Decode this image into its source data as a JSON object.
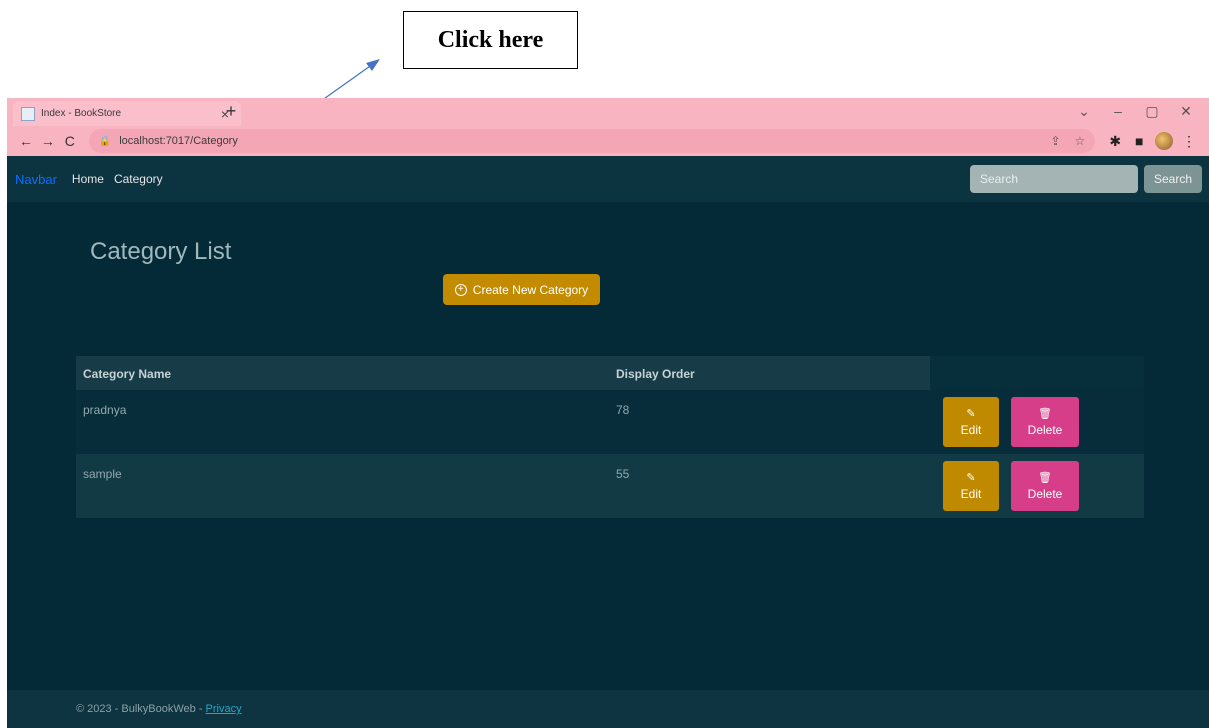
{
  "annotation": {
    "label": "Click here"
  },
  "browser": {
    "tab_title": "Index - BookStore",
    "tab_close": "×",
    "new_tab": "+",
    "window_controls": {
      "dropdown": "⌄",
      "minimize": "–",
      "restore": "▢",
      "close": "✕"
    },
    "url": "localhost:7017/Category",
    "nav": {
      "back": "←",
      "forward": "→",
      "reload": "C"
    }
  },
  "navbar": {
    "brand": "Navbar",
    "links": [
      "Home",
      "Category"
    ],
    "search_placeholder": "Search",
    "search_button": "Search"
  },
  "main": {
    "title": "Category List",
    "create_button": "Create New Category"
  },
  "table": {
    "headers": [
      "Category Name",
      "Display Order"
    ],
    "rows": [
      {
        "name": "pradnya",
        "order": "78"
      },
      {
        "name": "sample",
        "order": "55"
      }
    ],
    "edit_label": "Edit",
    "delete_label": "Delete"
  },
  "footer": {
    "text": "© 2023 - BulkyBookWeb -",
    "link": "Privacy"
  },
  "colors": {
    "tabstrip": "#f9b4c2",
    "page_bg": "#032a36",
    "edit": "#c08a00",
    "delete": "#d63e8a",
    "brand": "#0d6efd"
  }
}
